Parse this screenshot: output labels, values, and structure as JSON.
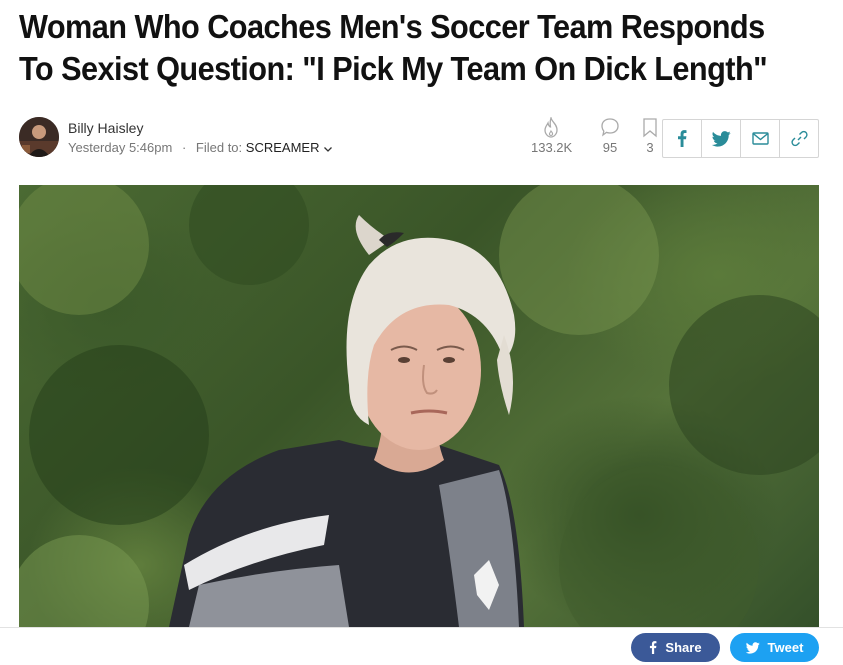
{
  "article": {
    "headline": "Woman Who Coaches Men's Soccer Team Responds To Sexist Question: \"I Pick My Team On Dick Length\"",
    "author": "Billy Haisley",
    "timestamp": "Yesterday 5:46pm",
    "separator": "·",
    "filed_to_label": "Filed to:",
    "category": "SCREAMER"
  },
  "stats": {
    "views": "133.2K",
    "comments": "95",
    "bookmarks": "3"
  },
  "share_icons": [
    "facebook-icon",
    "twitter-icon",
    "email-icon",
    "link-icon"
  ],
  "bottom_bar": {
    "share_label": "Share",
    "tweet_label": "Tweet"
  },
  "colors": {
    "share_icon": "#2a8c99",
    "facebook": "#3b5998",
    "twitter": "#1da1f2",
    "stat_gray": "#777777"
  }
}
